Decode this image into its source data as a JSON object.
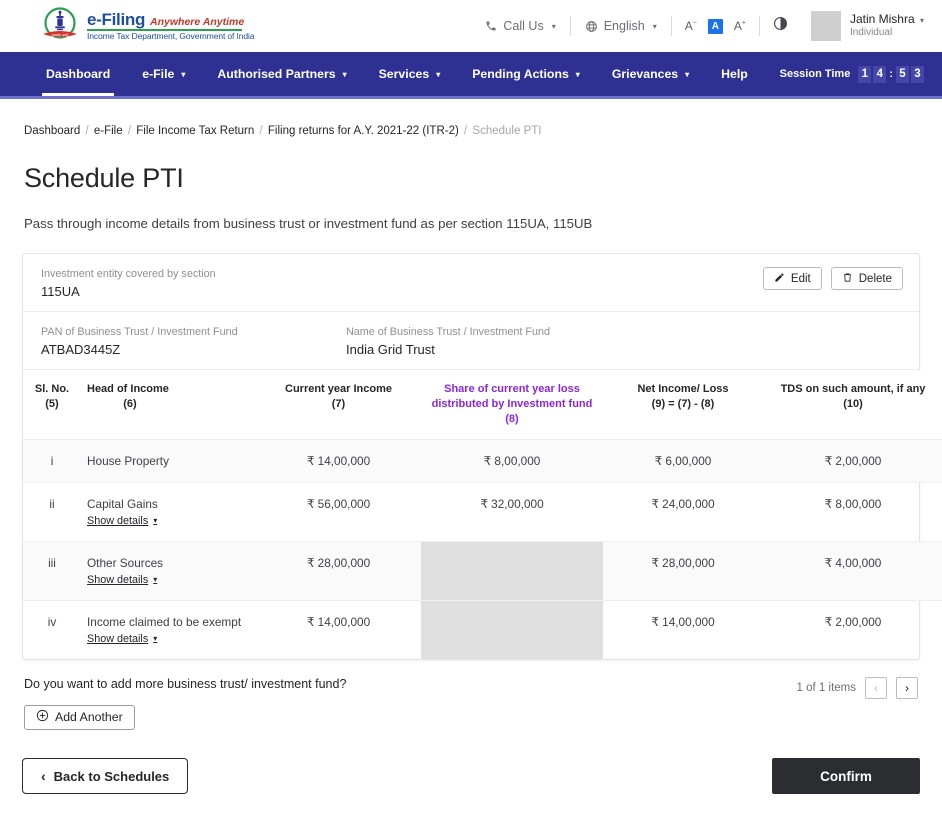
{
  "header": {
    "brand": {
      "name": "e-Filing",
      "tagline": "Anywhere Anytime",
      "department": "Income Tax Department, Government of India",
      "emblem_icon": "india-emblem-icon"
    },
    "call_us": "Call Us",
    "language": "English",
    "font_decrease": "A",
    "font_normal": "A",
    "font_increase": "A",
    "contrast_icon": "contrast-icon",
    "user": {
      "name": "Jatin Mishra",
      "type": "Individual"
    }
  },
  "nav": {
    "items": [
      {
        "label": "Dashboard",
        "has_caret": false,
        "active": true
      },
      {
        "label": "e-File",
        "has_caret": true,
        "active": false
      },
      {
        "label": "Authorised Partners",
        "has_caret": true,
        "active": false
      },
      {
        "label": "Services",
        "has_caret": true,
        "active": false
      },
      {
        "label": "Pending Actions",
        "has_caret": true,
        "active": false
      },
      {
        "label": "Grievances",
        "has_caret": true,
        "active": false
      },
      {
        "label": "Help",
        "has_caret": false,
        "active": false
      }
    ],
    "session_label": "Session Time",
    "session_digits": [
      "1",
      "4",
      "5",
      "3"
    ],
    "session_separator": ":"
  },
  "breadcrumb": {
    "items": [
      "Dashboard",
      "e-File",
      "File Income Tax Return",
      "Filing returns for A.Y. 2021-22 (ITR-2)"
    ],
    "current": "Schedule PTI",
    "separator": "/"
  },
  "page": {
    "title": "Schedule PTI",
    "subtitle": "Pass through income details from business trust or investment fund as per section 115UA, 115UB"
  },
  "card": {
    "entity_label": "Investment entity covered by section",
    "entity_value": "115UA",
    "pan_label": "PAN of Business Trust / Investment Fund",
    "pan_value": "ATBAD3445Z",
    "name_label": "Name of Business Trust / Investment Fund",
    "name_value": "India Grid Trust",
    "edit_label": "Edit",
    "edit_icon": "pencil-icon",
    "delete_label": "Delete",
    "delete_icon": "trash-icon"
  },
  "table": {
    "headers": [
      {
        "line1": "Sl. No.",
        "line2": "",
        "line3": "",
        "num": "(5)",
        "highlight": false
      },
      {
        "line1": "Head of Income",
        "line2": "",
        "line3": "",
        "num": "(6)",
        "highlight": false
      },
      {
        "line1": "Current year Income",
        "line2": "",
        "line3": "",
        "num": "(7)",
        "highlight": false
      },
      {
        "line1": "Share of current year loss",
        "line2": "distributed by Investment fund",
        "line3": "",
        "num": "(8)",
        "highlight": true
      },
      {
        "line1": "Net Income/ Loss",
        "line2": "(9) = (7) - (8)",
        "line3": "",
        "num": "",
        "highlight": false
      },
      {
        "line1": "TDS on such amount, if any",
        "line2": "",
        "line3": "",
        "num": "(10)",
        "highlight": false
      }
    ],
    "show_details_label": "Show details",
    "rows": [
      {
        "sl": "i",
        "head": "House Property",
        "has_details": false,
        "current_year_income": "₹ 14,00,000",
        "share_loss": "₹ 8,00,000",
        "share_loss_disabled": false,
        "net_income": "₹ 6,00,000",
        "tds": "₹ 2,00,000"
      },
      {
        "sl": "ii",
        "head": "Capital Gains",
        "has_details": true,
        "current_year_income": "₹ 56,00,000",
        "share_loss": "₹ 32,00,000",
        "share_loss_disabled": false,
        "net_income": "₹ 24,00,000",
        "tds": "₹ 8,00,000"
      },
      {
        "sl": "iii",
        "head": "Other Sources",
        "has_details": true,
        "current_year_income": "₹ 28,00,000",
        "share_loss": "",
        "share_loss_disabled": true,
        "net_income": "₹ 28,00,000",
        "tds": "₹ 4,00,000"
      },
      {
        "sl": "iv",
        "head": "Income claimed to be exempt",
        "has_details": true,
        "current_year_income": "₹ 14,00,000",
        "share_loss": "",
        "share_loss_disabled": true,
        "net_income": "₹ 14,00,000",
        "tds": "₹ 2,00,000"
      }
    ]
  },
  "below": {
    "question": "Do you want to add more business trust/ investment fund?",
    "add_another": "Add Another",
    "add_icon": "plus-circle-icon",
    "pager_text": "1 of 1 items",
    "prev_icon": "chevron-left-icon",
    "next_icon": "chevron-right-icon"
  },
  "footer": {
    "back_label": "Back to Schedules",
    "back_icon": "chevron-left-icon",
    "confirm_label": "Confirm"
  },
  "colors": {
    "nav_blue": "#2e3191",
    "brand_blue": "#1d4f9e",
    "highlight_purple": "#8b27d6",
    "accent_blue": "#1a73e8",
    "dark": "#2b2d31"
  }
}
